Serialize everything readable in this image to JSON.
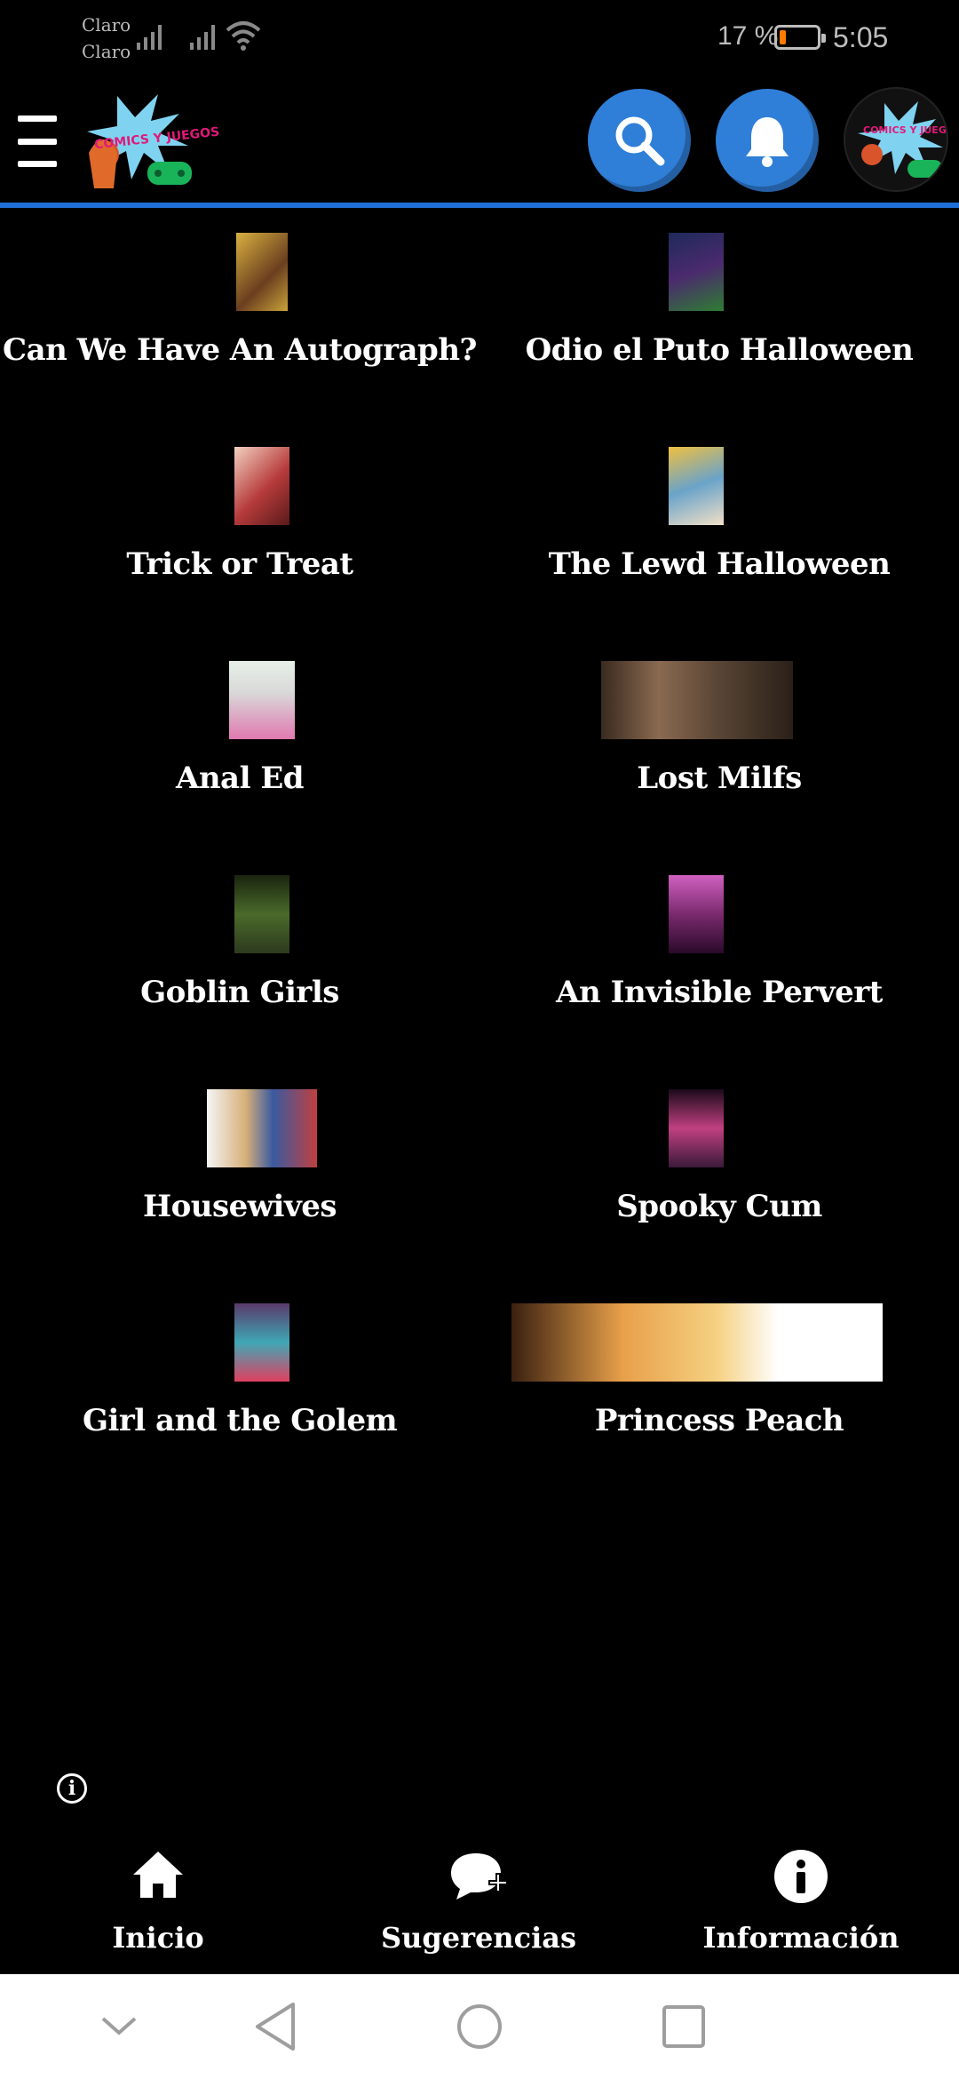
{
  "status_bar": {
    "carrier_1": "Claro",
    "carrier_2": "Claro",
    "battery_percent": "17 %",
    "battery_level": 0.17,
    "time": "5:05"
  },
  "app_bar": {
    "logo_text": "COMICS Y JUEGOS",
    "icons": [
      "menu-icon",
      "search-icon",
      "bell-icon"
    ]
  },
  "comics": [
    {
      "title": "Can We Have An Autograph?",
      "thumb_color": "#c9a23a"
    },
    {
      "title": "Odio el Puto Halloween",
      "thumb_color": "#4b2a6e"
    },
    {
      "title": "Trick or Treat",
      "thumb_color": "#b63b3b"
    },
    {
      "title": "The Lewd Halloween",
      "thumb_color": "#6aa3c9"
    },
    {
      "title": "Anal Ed",
      "thumb_color": "#d9d9d9"
    },
    {
      "title": "Lost Milfs",
      "thumb_color": "#5a4636"
    },
    {
      "title": "Goblin Girls",
      "thumb_color": "#2d3a1e"
    },
    {
      "title": "An Invisible Pervert",
      "thumb_color": "#7a2a6e"
    },
    {
      "title": "Housewives",
      "thumb_color": "#d8b07a"
    },
    {
      "title": "Spooky Cum",
      "thumb_color": "#3a1a3a"
    },
    {
      "title": "Girl and the Golem",
      "thumb_color": "#3fa7b5"
    },
    {
      "title": "Princess Peach",
      "thumb_color": "#e8a04a"
    }
  ],
  "bottom_nav": {
    "home": "Inicio",
    "suggestions": "Sugerencias",
    "info": "Información"
  }
}
